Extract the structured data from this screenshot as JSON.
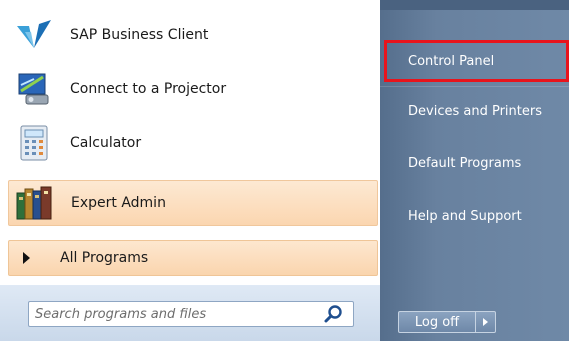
{
  "programs": [
    {
      "label": "SAP Business Client",
      "icon": "sap-business-client-icon"
    },
    {
      "label": "Connect to a Projector",
      "icon": "projector-icon"
    },
    {
      "label": "Calculator",
      "icon": "calculator-icon"
    },
    {
      "label": "Expert Admin",
      "icon": "expert-admin-icon"
    }
  ],
  "all_programs": {
    "label": "All Programs"
  },
  "search": {
    "placeholder": "Search programs and files",
    "value": ""
  },
  "right_items": [
    {
      "label": "Control Panel"
    },
    {
      "label": "Devices and Printers"
    },
    {
      "label": "Default Programs"
    },
    {
      "label": "Help and Support"
    }
  ],
  "logoff": {
    "label": "Log off"
  },
  "colors": {
    "highlight": "#fbd6b0",
    "right_pane": "#6f89a7",
    "selection_border": "#e8141c"
  }
}
